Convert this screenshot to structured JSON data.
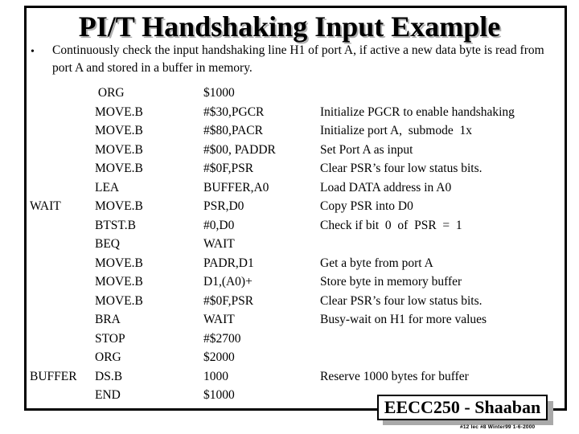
{
  "slide": {
    "title": "PI/T Handshaking Input Example",
    "bullet_symbol": "•",
    "intro": "Continuously check the input handshaking line H1 of port A,  if active a new data byte is read from port A and stored in a buffer in memory.",
    "code": [
      {
        "label": "",
        "op": " ORG",
        "arg": "$1000",
        "comment": ""
      },
      {
        "label": "",
        "op": "MOVE.B",
        "arg": "#$30,PGCR",
        "comment": "Initialize PGCR to enable handshaking"
      },
      {
        "label": "",
        "op": "MOVE.B",
        "arg": "#$80,PACR",
        "comment": "Initialize port A,  submode  1x"
      },
      {
        "label": "",
        "op": "MOVE.B",
        "arg": "#$00, PADDR",
        "comment": "Set Port A as input"
      },
      {
        "label": "",
        "op": "MOVE.B",
        "arg": "#$0F,PSR",
        "comment": "Clear PSR’s four low status bits."
      },
      {
        "label": "",
        "op": "LEA",
        "arg": "BUFFER,A0",
        "comment": "Load DATA address in A0"
      },
      {
        "label": "WAIT",
        "op": "MOVE.B",
        "arg": "PSR,D0",
        "comment": "Copy PSR into D0"
      },
      {
        "label": "",
        "op": "BTST.B",
        "arg": "#0,D0",
        "comment": "Check if bit  0  of  PSR  =  1"
      },
      {
        "label": "",
        "op": "BEQ",
        "arg": "WAIT",
        "comment": ""
      },
      {
        "label": "",
        "op": "MOVE.B",
        "arg": "PADR,D1",
        "comment": "Get a byte from port A"
      },
      {
        "label": "",
        "op": "MOVE.B",
        "arg": "D1,(A0)+",
        "comment": "Store byte in memory buffer"
      },
      {
        "label": "",
        "op": "MOVE.B",
        "arg": "#$0F,PSR",
        "comment": "Clear PSR’s four low status bits."
      },
      {
        "label": "",
        "op": "BRA",
        "arg": "WAIT",
        "comment": "Busy-wait on H1 for more values"
      },
      {
        "label": "",
        "op": "STOP",
        "arg": "#$2700",
        "comment": ""
      },
      {
        "label": "",
        "op": "ORG",
        "arg": "$2000",
        "comment": ""
      },
      {
        "label": "BUFFER",
        "op": "DS.B",
        "arg": "1000",
        "comment": "Reserve 1000 bytes for buffer"
      },
      {
        "label": "",
        "op": "END",
        "arg": "$1000",
        "comment": ""
      }
    ],
    "badge": "EECC250 - Shaaban",
    "footer": "#12 lec #8  Winter99  1-6-2000"
  }
}
